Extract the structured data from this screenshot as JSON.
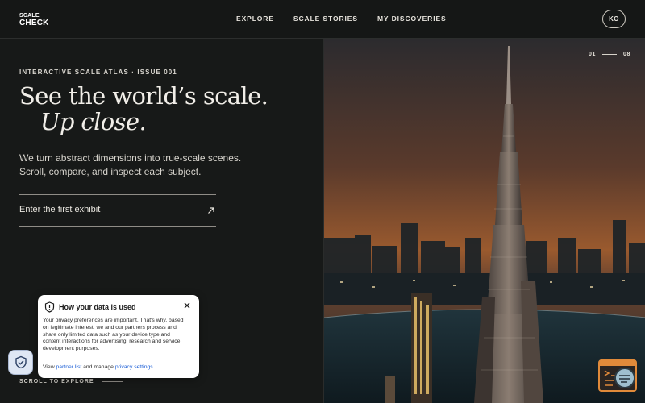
{
  "header": {
    "logo_line1": "SCALE",
    "logo_line2": "CHECK",
    "nav": [
      "EXPLORE",
      "SCALE STORIES",
      "MY DISCOVERIES"
    ],
    "avatar_initials": "KO"
  },
  "hero": {
    "eyebrow": "INTERACTIVE SCALE ATLAS · ISSUE 001",
    "headline_line1": "See the world’s scale.",
    "headline_line2": "Up close.",
    "description": "We turn abstract dimensions into true-scale scenes. Scroll, compare, and inspect each subject.",
    "cta_label": "Enter the first exhibit",
    "cta_icon": "arrow-up-right-icon",
    "scroll_label": "SCROLL TO EXPLORE"
  },
  "exhibit": {
    "current": "01",
    "total": "08",
    "image_subject": "skyscraper-at-dusk"
  },
  "privacy": {
    "title": "How your data is used",
    "body": "Your privacy preferences are important. That's why, based on legitimate interest, we and our partners process and share only limited data such as your device type and content interactions for advertising, research and service development purposes.",
    "footer_prefix": "View",
    "partner_link": "partner list",
    "footer_middle": "and manage",
    "settings_link": "privacy settings",
    "footer_suffix": "."
  },
  "colors": {
    "background": "#161817",
    "text": "#e9e6df",
    "link": "#1c5fd6",
    "chat_accent": "#e08a3a"
  }
}
